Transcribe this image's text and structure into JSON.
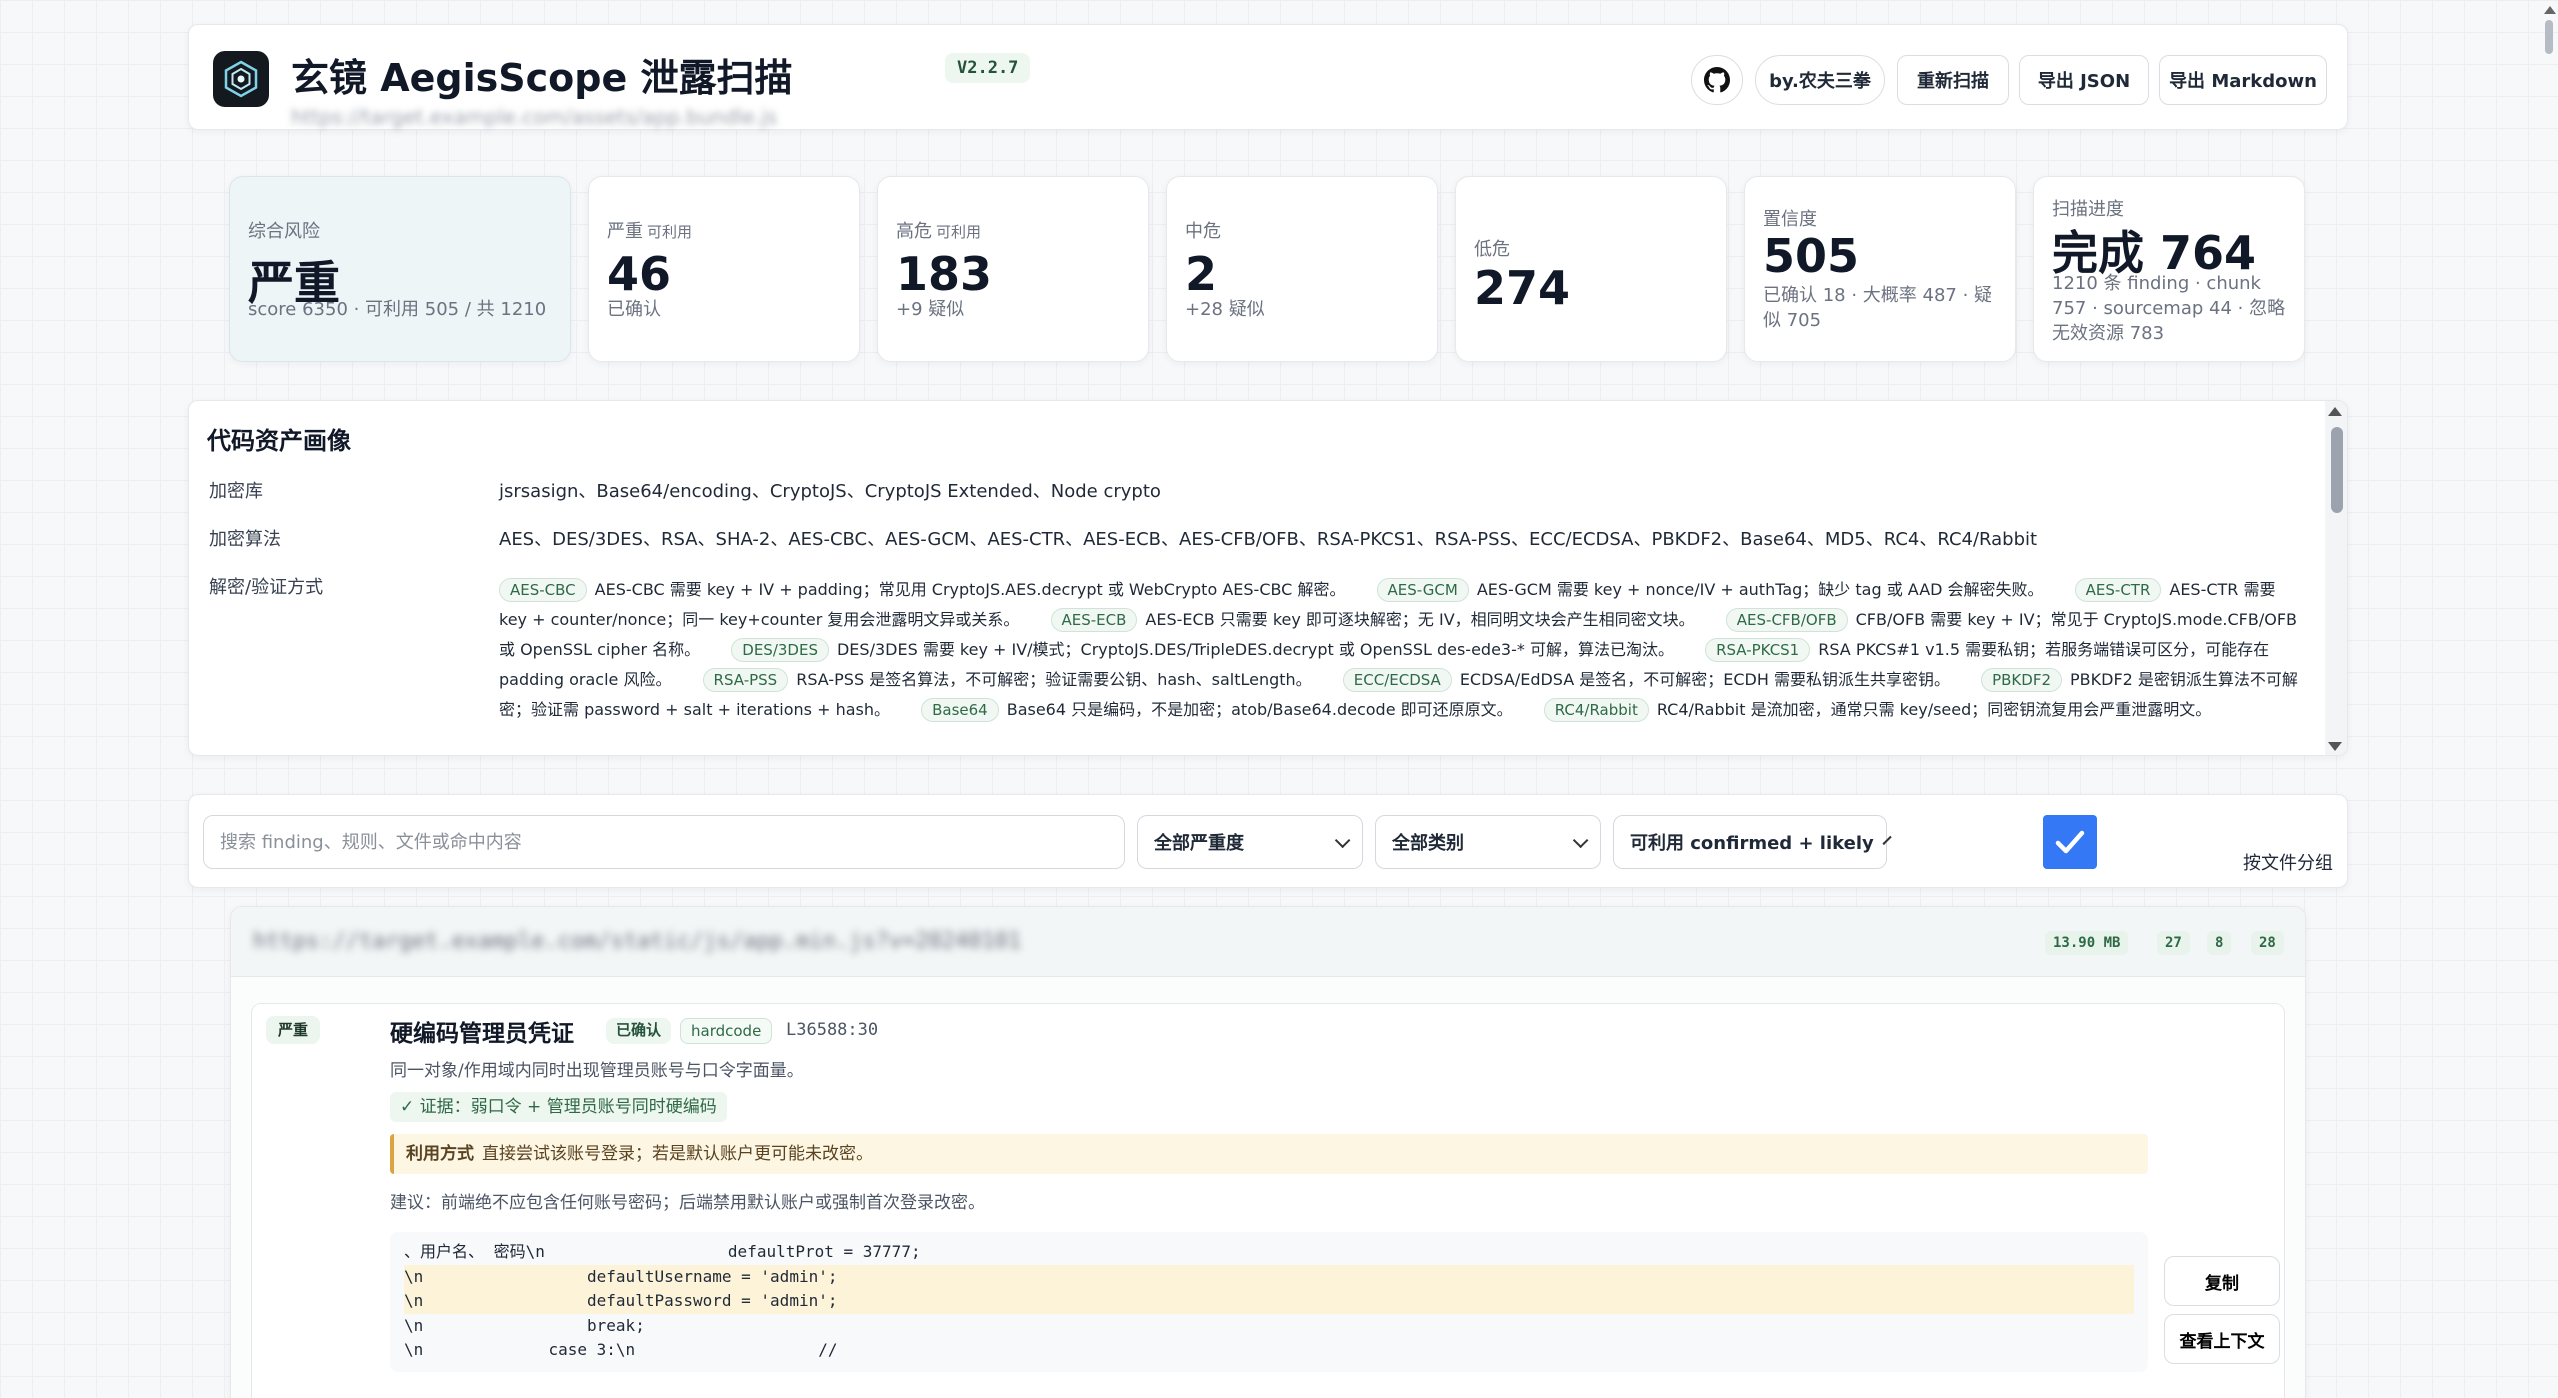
{
  "header": {
    "title": "玄镜 AegisScope 泄露扫描",
    "version": "V2.2.7",
    "subtitle": "https://target.example.com/assets/app.bundle.js",
    "author_button": "by.农夫三拳",
    "rescan_button": "重新扫描",
    "export_json_button": "导出 JSON",
    "export_md_button": "导出 Markdown",
    "github_icon": "github-icon"
  },
  "stats": {
    "overall": {
      "label": "综合风险",
      "value": "严重",
      "sub": "score 6350 · 可利用 505 / 共 1210"
    },
    "critical": {
      "label": "严重",
      "tag": "可利用",
      "value": "46",
      "sub": "已确认"
    },
    "high": {
      "label": "高危",
      "tag": "可利用",
      "value": "183",
      "sub": "+9 疑似"
    },
    "medium": {
      "label": "中危",
      "value": "2",
      "sub": "+28 疑似"
    },
    "low": {
      "label": "低危",
      "value": "274"
    },
    "confidence": {
      "label": "置信度",
      "value": "505",
      "sub": "已确认 18 · 大概率 487 · 疑似 705"
    },
    "progress": {
      "label": "扫描进度",
      "value": "完成 764",
      "sub": "1210 条 finding · chunk 757 · sourcemap 44 · 忽略无效资源 783"
    }
  },
  "assets": {
    "title": "代码资产画像",
    "libs_label": "加密库",
    "libs_value": "jsrsasign、Base64/encoding、CryptoJS、CryptoJS Extended、Node crypto",
    "algos_label": "加密算法",
    "algos_value": "AES、DES/3DES、RSA、SHA-2、AES-CBC、AES-GCM、AES-CTR、AES-ECB、AES-CFB/OFB、RSA-PKCS1、RSA-PSS、ECC/ECDSA、PBKDF2、Base64、MD5、RC4、RC4/Rabbit",
    "decrypt_label": "解密/验证方式",
    "methods": [
      {
        "tag": "AES-CBC",
        "desc": "AES-CBC 需要 key + IV + padding；常见用 CryptoJS.AES.decrypt 或 WebCrypto AES-CBC 解密。"
      },
      {
        "tag": "AES-GCM",
        "desc": "AES-GCM 需要 key + nonce/IV + authTag；缺少 tag 或 AAD 会解密失败。"
      },
      {
        "tag": "AES-CTR",
        "desc": "AES-CTR 需要 key + counter/nonce；同一 key+counter 复用会泄露明文异或关系。"
      },
      {
        "tag": "AES-ECB",
        "desc": "AES-ECB 只需要 key 即可逐块解密；无 IV，相同明文块会产生相同密文块。"
      },
      {
        "tag": "AES-CFB/OFB",
        "desc": "CFB/OFB 需要 key + IV；常见于 CryptoJS.mode.CFB/OFB 或 OpenSSL cipher 名称。"
      },
      {
        "tag": "DES/3DES",
        "desc": "DES/3DES 需要 key + IV/模式；CryptoJS.DES/TripleDES.decrypt 或 OpenSSL des-ede3-* 可解，算法已淘汰。"
      },
      {
        "tag": "RSA-PKCS1",
        "desc": "RSA PKCS#1 v1.5 需要私钥；若服务端错误可区分，可能存在 padding oracle 风险。"
      },
      {
        "tag": "RSA-PSS",
        "desc": "RSA-PSS 是签名算法，不可解密；验证需要公钥、hash、saltLength。"
      },
      {
        "tag": "ECC/ECDSA",
        "desc": "ECDSA/EdDSA 是签名，不可解密；ECDH 需要私钥派生共享密钥。"
      },
      {
        "tag": "PBKDF2",
        "desc": "PBKDF2 是密钥派生算法不可解密；验证需 password + salt + iterations + hash。"
      },
      {
        "tag": "Base64",
        "desc": "Base64 只是编码，不是加密；atob/Base64.decode 即可还原原文。"
      },
      {
        "tag": "RC4/Rabbit",
        "desc": "RC4/Rabbit 是流加密，通常只需 key/seed；同密钥流复用会严重泄露明文。"
      }
    ]
  },
  "filters": {
    "search_placeholder": "搜索 finding、规则、文件或命中内容",
    "severity": "全部严重度",
    "category": "全部类别",
    "status": "可利用 confirmed + likely",
    "group_label": "按文件分组",
    "group_checked": true
  },
  "file_group": {
    "path": "https://target.example.com/static/js/app.min.js?v=20240101",
    "size": "13.90 MB",
    "count_critical": "27",
    "count_high": "8",
    "count_medium": "28"
  },
  "finding": {
    "severity": "严重",
    "title": "硬编码管理员凭证",
    "status": "已确认",
    "rule": "hardcode",
    "location": "L36588:30",
    "description": "同一对象/作用域内同时出现管理员账号与口令字面量。",
    "evidence": "✓ 证据：弱口令 + 管理员账号同时硬编码",
    "exploit_label": "利用方式",
    "exploit_text": "直接尝试该账号登录；若是默认账户更可能未改密。",
    "advice": "建议：前端绝不应包含任何账号密码；后端禁用默认账户或强制首次登录改密。",
    "code_lines": [
      "、用户名、 密码\\n                   defaultProt = 37777;",
      "\\n                 defaultUsername = 'admin';",
      "\\n                 defaultPassword = 'admin';",
      "\\n                 break;",
      "\\n             case 3:\\n                   //"
    ],
    "copy_button": "复制",
    "context_button": "查看上下文"
  }
}
